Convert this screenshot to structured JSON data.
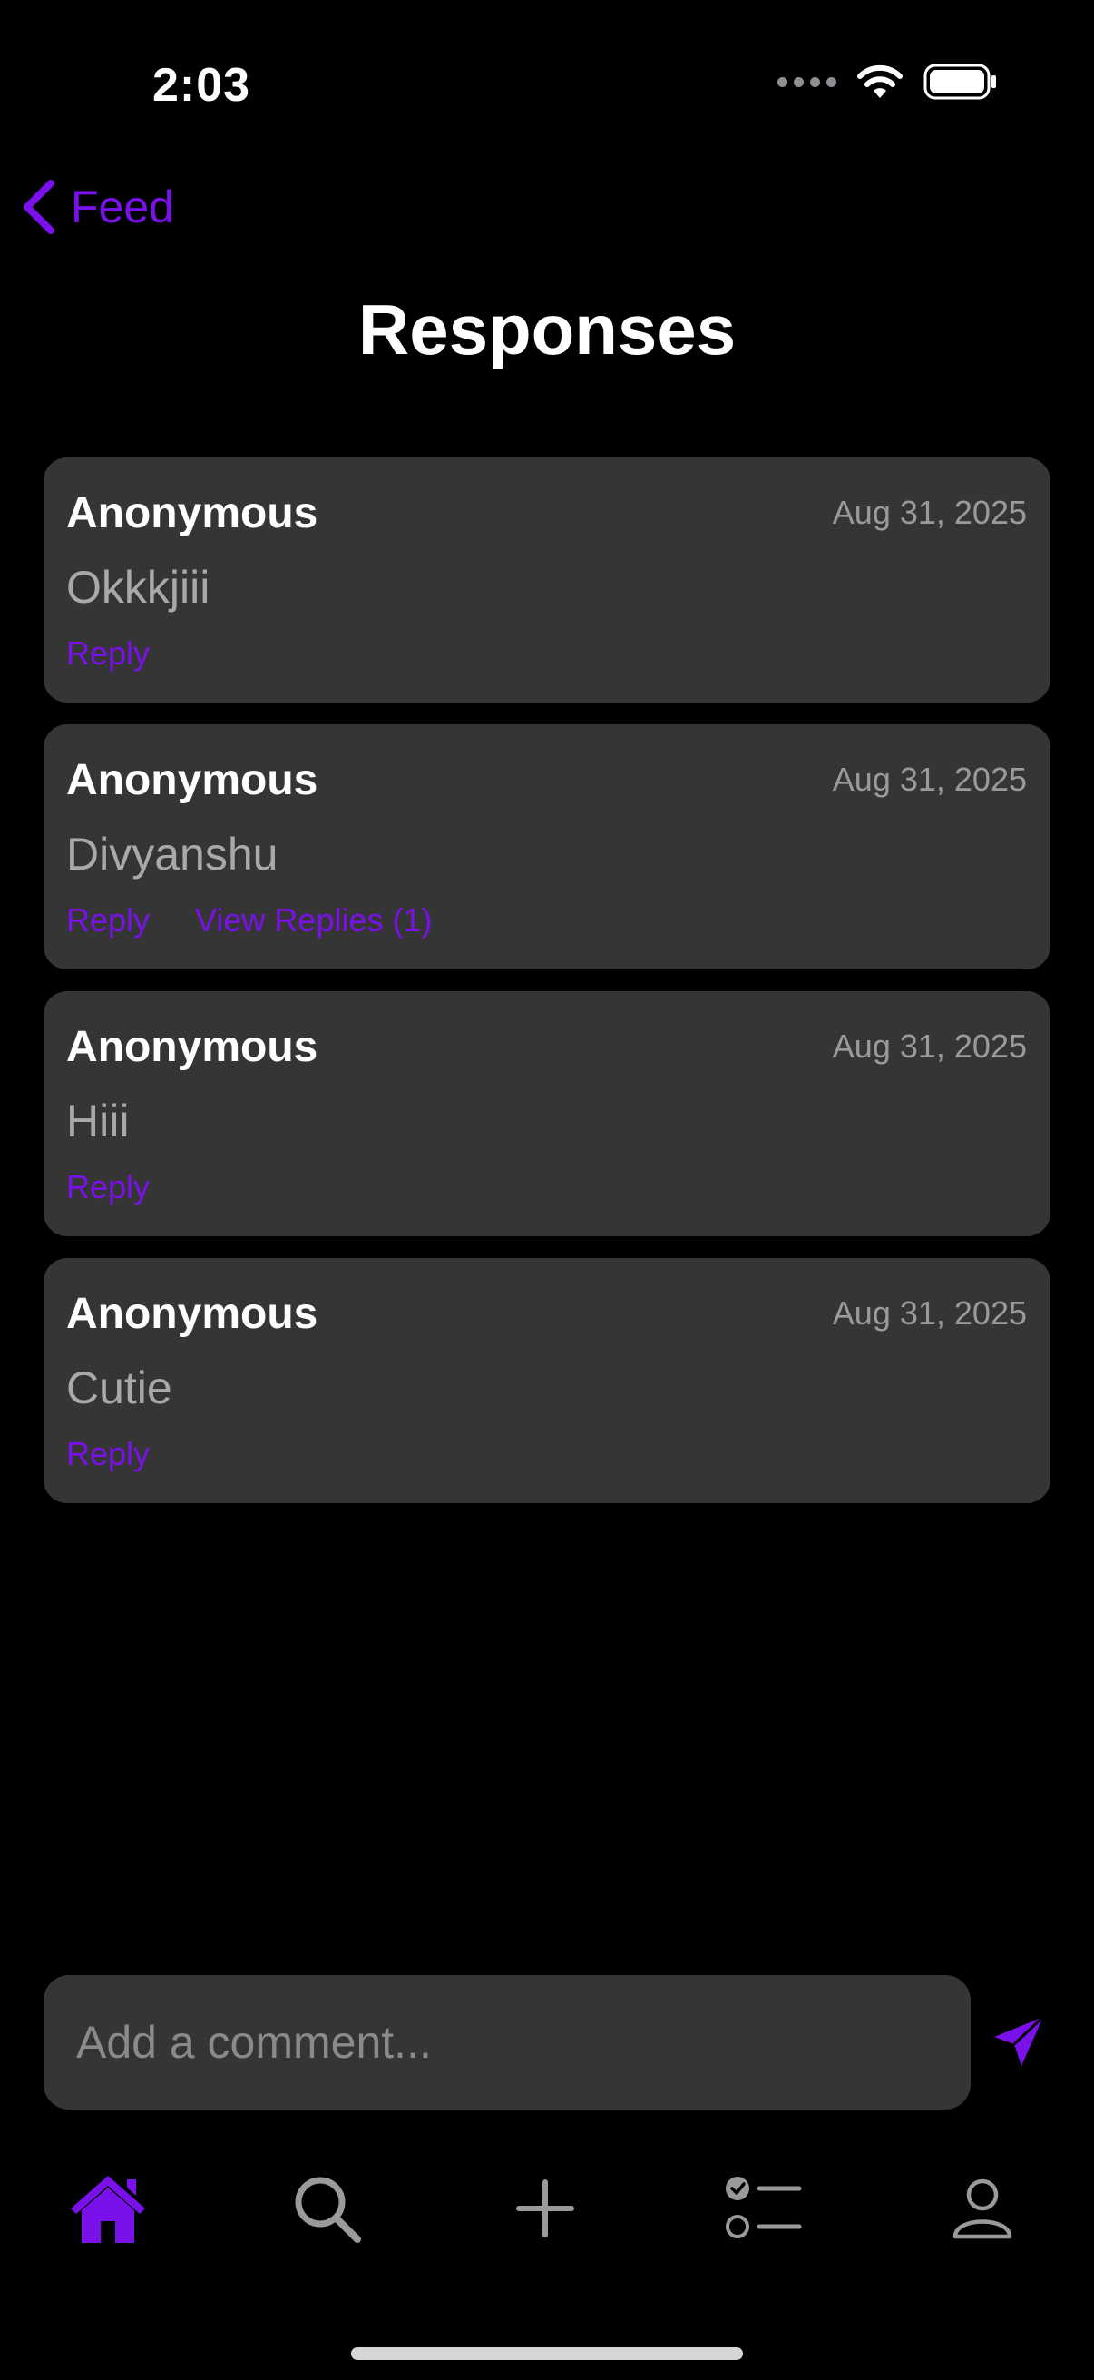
{
  "status_bar": {
    "time": "2:03"
  },
  "nav": {
    "back_label": "Feed",
    "title": "Responses"
  },
  "comments": [
    {
      "author": "Anonymous",
      "date": "Aug 31, 2025",
      "text": "Okkkjiii",
      "reply_label": "Reply",
      "view_replies_label": ""
    },
    {
      "author": "Anonymous",
      "date": "Aug 31, 2025",
      "text": "Divyanshu",
      "reply_label": "Reply",
      "view_replies_label": "View Replies (1)"
    },
    {
      "author": "Anonymous",
      "date": "Aug 31, 2025",
      "text": "Hiii",
      "reply_label": "Reply",
      "view_replies_label": ""
    },
    {
      "author": "Anonymous",
      "date": "Aug 31, 2025",
      "text": "Cutie",
      "reply_label": "Reply",
      "view_replies_label": ""
    }
  ],
  "composer": {
    "placeholder": "Add a comment...",
    "send_icon": "send-icon"
  },
  "tab_bar": {
    "tabs": [
      {
        "icon": "home-icon",
        "active": true
      },
      {
        "icon": "search-icon",
        "active": false
      },
      {
        "icon": "plus-icon",
        "active": false
      },
      {
        "icon": "checklist-icon",
        "active": false
      },
      {
        "icon": "profile-icon",
        "active": false
      }
    ]
  },
  "colors": {
    "accent": "#7a10ea",
    "card": "#353535",
    "background": "#000000"
  }
}
